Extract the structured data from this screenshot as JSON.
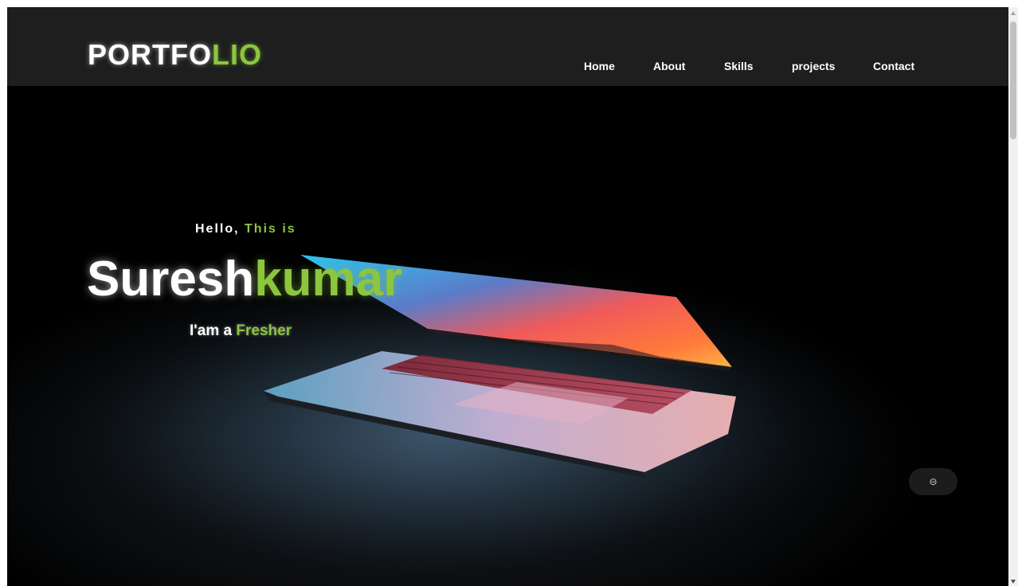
{
  "header": {
    "logo_main": "PORTFO",
    "logo_accent": "LIO",
    "nav": [
      {
        "label": "Home"
      },
      {
        "label": "About"
      },
      {
        "label": "Skills"
      },
      {
        "label": "projects"
      },
      {
        "label": "Contact"
      }
    ]
  },
  "hero": {
    "greeting_main": "Hello,",
    "greeting_accent": "This is",
    "name_main": "Suresh",
    "name_accent": "kumar",
    "role_main": "I'am a",
    "role_accent": "Fresher",
    "scroll_button_icon": "scroll-top-icon",
    "scroll_button_glyph": "⊝"
  },
  "colors": {
    "accent": "#8cc63e",
    "navbar_bg": "#1e1e1e",
    "hero_bg": "#000000"
  }
}
